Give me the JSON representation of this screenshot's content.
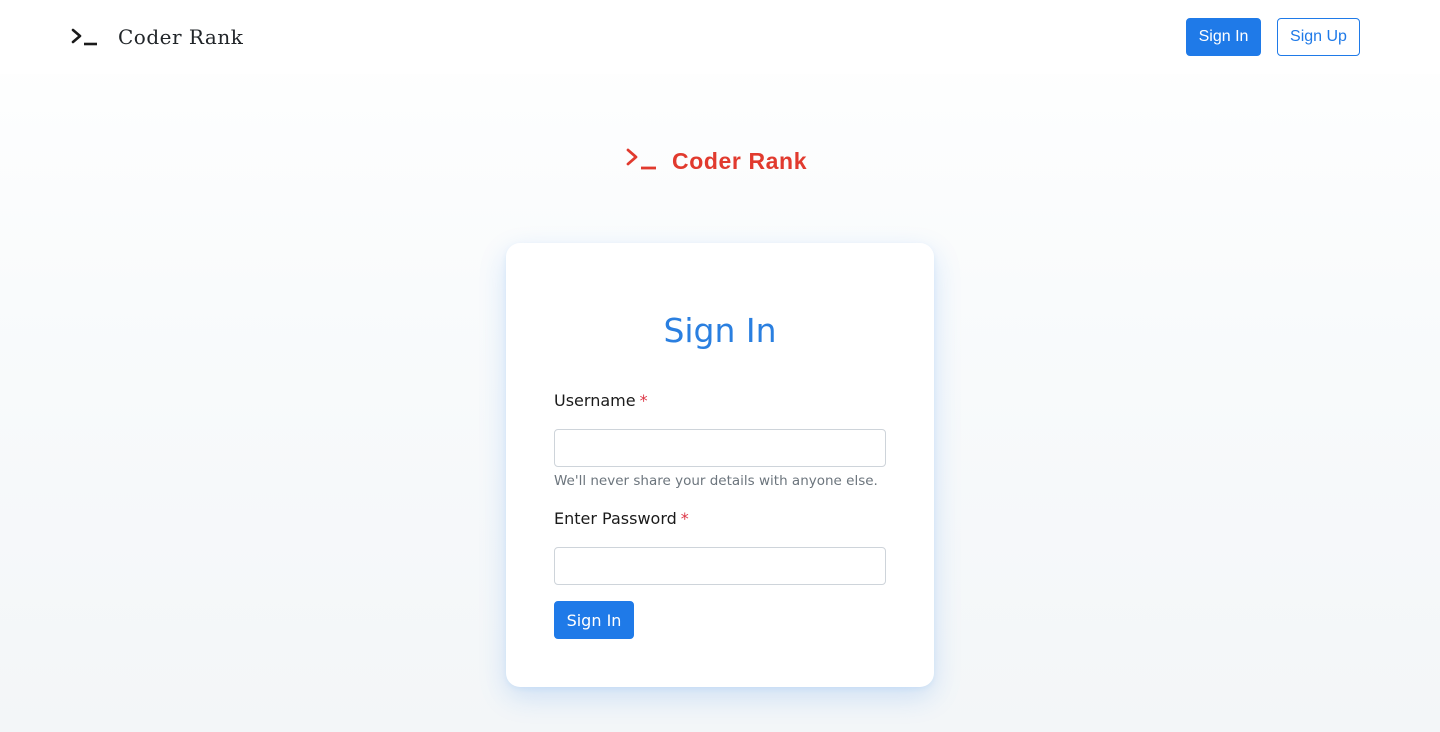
{
  "navbar": {
    "brand_icon": "terminal-prompt-icon",
    "brand_text": "Coder Rank",
    "signin_label": "Sign In",
    "signup_label": "Sign Up"
  },
  "hero": {
    "logo_icon": "terminal-prompt-icon",
    "logo_text": "Coder Rank"
  },
  "form": {
    "title": "Sign In",
    "username_label": "Username",
    "username_required": "*",
    "username_value": "",
    "help_text": "We'll never share your details with anyone else.",
    "password_label": "Enter Password",
    "password_required": "*",
    "password_value": "",
    "submit_label": "Sign In"
  },
  "colors": {
    "primary": "#1f7ae8",
    "brand_red": "#e13a2e",
    "required": "#dc3545",
    "muted": "#6c757d"
  }
}
